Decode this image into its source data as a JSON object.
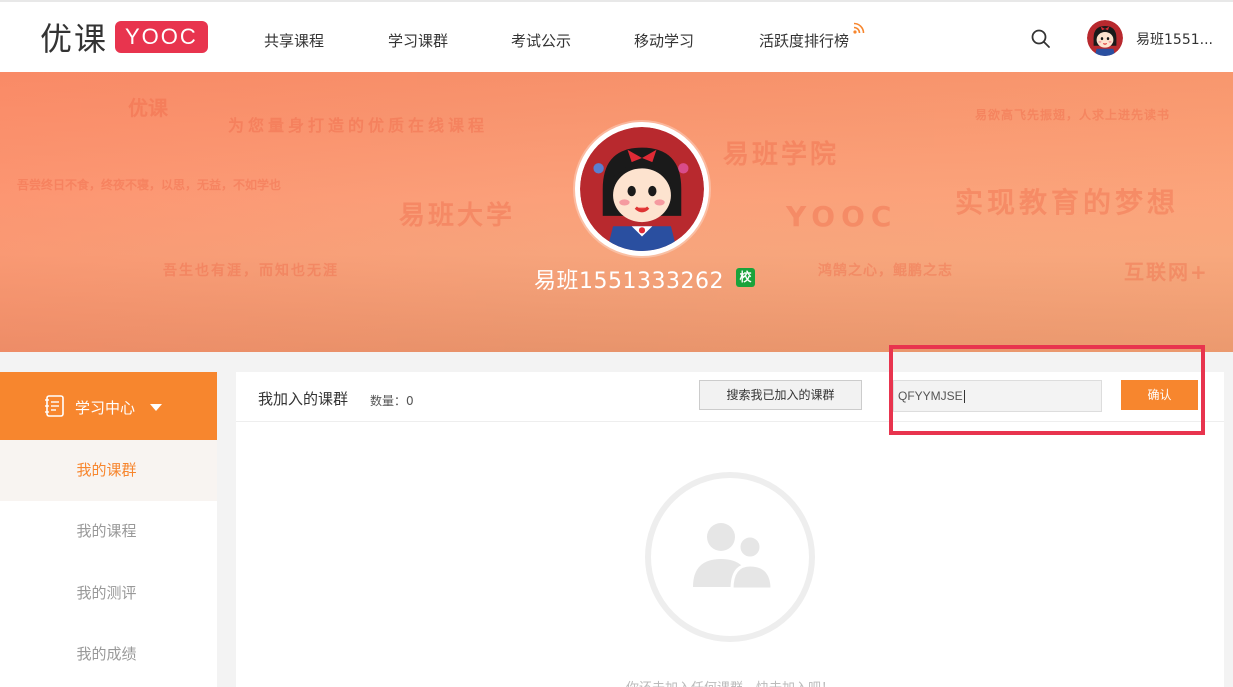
{
  "header": {
    "logo_text": "优课",
    "logo_badge": "YOOC",
    "nav": [
      "共享课程",
      "学习课群",
      "考试公示",
      "移动学习",
      "活跃度排行榜"
    ],
    "username": "易班1551..."
  },
  "banner": {
    "watermarks": [
      "优课",
      "为您量身打造的优质在线课程",
      "易班学院",
      "易欲高飞先振翅，人求上进先读书",
      "吾尝终日不食，终夜不寝，以思，无益，不如学也",
      "易班大学",
      "YOOC",
      "实现教育的梦想",
      "吾生也有涯，而知也无涯",
      "鸿鹄之心，鲲鹏之志",
      "互联网+"
    ],
    "name": "易班1551333262",
    "school_badge": "校"
  },
  "sidebar": {
    "title": "学习中心",
    "items": [
      "我的课群",
      "我的课程",
      "我的测评",
      "我的成绩"
    ]
  },
  "main": {
    "title": "我加入的课群",
    "count": "数量：0",
    "search_joined": "搜索我已加入的课群",
    "code_value": "QFYYMJSE",
    "confirm": "确认",
    "empty_text": "你还未加入任何课群，快去加入吧！"
  },
  "colors": {
    "accent": "#f7862e",
    "brand_red": "#e8344e",
    "highlight": "#e8344e"
  }
}
